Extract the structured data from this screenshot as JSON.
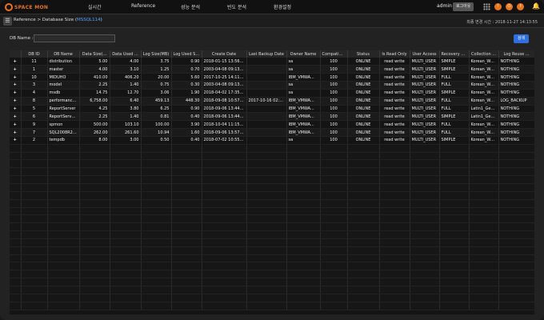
{
  "app": {
    "logo_text": "SPACE MON",
    "nav": [
      "실시간",
      "Reference",
      "성능 분석",
      "빈도 분석",
      "환경설정"
    ],
    "user": "admin",
    "logout_label": "로그아웃"
  },
  "header": {
    "breadcrumb_prefix": "Reference > Database Size (",
    "breadcrumb_highlight": "MSSQL114",
    "breadcrumb_suffix": ")",
    "updated": "최종 변경 시간 : 2018-11-27 14:13:55"
  },
  "search": {
    "label": "DB Name :",
    "value": "",
    "button": "검색"
  },
  "table": {
    "columns": [
      "",
      "DB ID",
      "DB Name",
      "Data Size(...",
      "Data Used ...",
      "Log Size(MB)",
      "Log Used Si...",
      "Create Date",
      "Last Backup Date",
      "Owner Name",
      "Compatibili...",
      "Status",
      "Is Read Only",
      "User Access",
      "Recovery M...",
      "Collection ...",
      "Log Reuse ..."
    ],
    "rows": [
      [
        "+",
        "11",
        "distribution",
        "5.00",
        "4.00",
        "3.75",
        "0.90",
        "2018-01-15 13:56:04",
        "",
        "sa",
        "100",
        "ONLINE",
        "read write",
        "MULTI_USER",
        "SIMPLE",
        "Korean_Wa...",
        "NOTHING"
      ],
      [
        "+",
        "1",
        "master",
        "4.00",
        "3.10",
        "1.25",
        "0.70",
        "2003-04-08 09:13:36",
        "",
        "sa",
        "100",
        "ONLINE",
        "read write",
        "MULTI_USER",
        "SIMPLE",
        "Korean_Wa...",
        "NOTHING"
      ],
      [
        "+",
        "10",
        "MIDUHO",
        "410.00",
        "406.20",
        "20.00",
        "5.60",
        "2017-10-25 14:11:12",
        "",
        "IBM_VMWA...",
        "100",
        "ONLINE",
        "read write",
        "MULTI_USER",
        "FULL",
        "Korean_Wa...",
        "NOTHING"
      ],
      [
        "+",
        "3",
        "model",
        "2.25",
        "1.40",
        "0.75",
        "0.30",
        "2003-04-08 09:13:36",
        "",
        "sa",
        "100",
        "ONLINE",
        "read write",
        "MULTI_USER",
        "FULL",
        "Korean_Wa...",
        "NOTHING"
      ],
      [
        "+",
        "4",
        "msdb",
        "14.75",
        "12.70",
        "3.06",
        "1.90",
        "2018-04-02 17:35:08",
        "",
        "sa",
        "100",
        "ONLINE",
        "read write",
        "MULTI_USER",
        "SIMPLE",
        "Korean_Wa...",
        "NOTHING"
      ],
      [
        "+",
        "8",
        "performance...",
        "6,758.00",
        "6.40",
        "459.13",
        "448.30",
        "2018-09-08 10:57:44",
        "2017-10-16 02:03:57",
        "IBM_VMWA...",
        "100",
        "ONLINE",
        "read write",
        "MULTI_USER",
        "FULL",
        "Korean_Wa...",
        "LOG_BACKUP"
      ],
      [
        "+",
        "5",
        "ReportServer",
        "4.25",
        "3.80",
        "6.25",
        "0.90",
        "2018-09-06 13:44:40",
        "",
        "IBM_VMWA...",
        "100",
        "ONLINE",
        "read write",
        "MULTI_USER",
        "FULL",
        "Latin1_Gene...",
        "NOTHING"
      ],
      [
        "+",
        "6",
        "ReportServer...",
        "2.25",
        "1.40",
        "0.81",
        "0.40",
        "2018-09-06 13:44:40",
        "",
        "IBM_VMWA...",
        "100",
        "ONLINE",
        "read write",
        "MULTI_USER",
        "SIMPLE",
        "Latin1_Gene...",
        "NOTHING"
      ],
      [
        "+",
        "9",
        "spmon",
        "500.00",
        "103.10",
        "100.00",
        "3.90",
        "2018-10-04 11:15:09",
        "",
        "IBM_VMWA...",
        "100",
        "ONLINE",
        "read write",
        "MULTI_USER",
        "FULL",
        "Korean_Wa...",
        "NOTHING"
      ],
      [
        "+",
        "7",
        "SQL2008R2_...",
        "262.00",
        "261.60",
        "10.94",
        "1.60",
        "2018-09-06 13:57:25",
        "",
        "IBM_VMWA...",
        "100",
        "ONLINE",
        "read write",
        "MULTI_USER",
        "FULL",
        "Korean_Wa...",
        "NOTHING"
      ],
      [
        "+",
        "2",
        "tempdb",
        "8.00",
        "3.00",
        "0.50",
        "0.40",
        "2018-07-02 10:55:42",
        "",
        "sa",
        "100",
        "ONLINE",
        "read write",
        "MULTI_USER",
        "SIMPLE",
        "Korean_Wa...",
        "NOTHING"
      ]
    ]
  }
}
